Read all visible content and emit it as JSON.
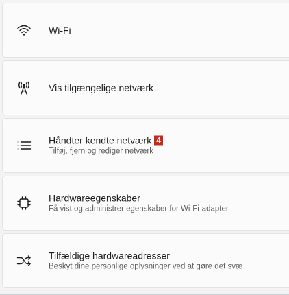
{
  "settings": {
    "items": [
      {
        "title": "Wi-Fi",
        "subtitle": "",
        "icon": "wifi-icon"
      },
      {
        "title": "Vis tilgængelige netværk",
        "subtitle": "",
        "icon": "antenna-icon"
      },
      {
        "title": "Håndter kendte netværk",
        "subtitle": "Tilføj, fjern og rediger netværk",
        "icon": "list-icon",
        "badge": "4"
      },
      {
        "title": "Hardwareegenskaber",
        "subtitle": "Få vist og administrer egenskaber for Wi-Fi-adapter",
        "icon": "chip-icon"
      },
      {
        "title": "Tilfældige hardwareadresser",
        "subtitle": "Beskyt dine personlige oplysninger ved at gøre det svæ",
        "icon": "shuffle-icon"
      }
    ]
  },
  "colors": {
    "background": "#f3f3f3",
    "card": "#fbfbfb",
    "badge": "#c42b1c"
  }
}
